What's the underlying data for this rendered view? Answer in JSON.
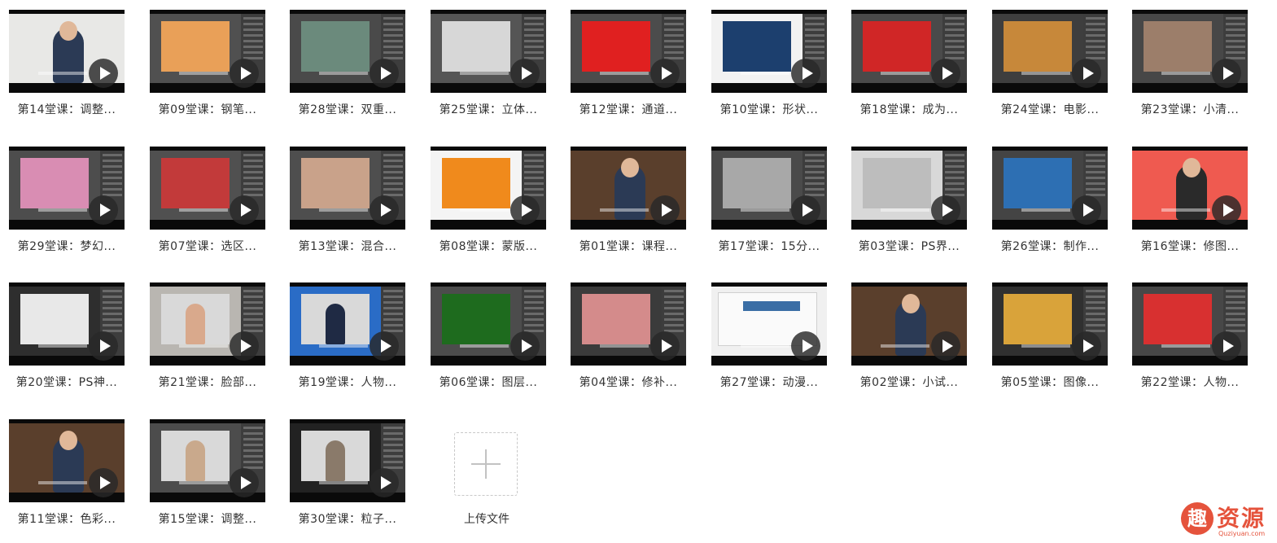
{
  "videos": [
    {
      "title": "第14堂课：调整...",
      "thumb": {
        "bg": "#e8e8e6",
        "ps": false,
        "accent": "#2b3a55",
        "person": true
      }
    },
    {
      "title": "第09堂课：钢笔...",
      "thumb": {
        "bg": "#505050",
        "ps": true,
        "accent": "#e9a058",
        "person": false
      }
    },
    {
      "title": "第28堂课：双重...",
      "thumb": {
        "bg": "#4a4a4a",
        "ps": true,
        "accent": "#6b8a7c",
        "person": false
      }
    },
    {
      "title": "第25堂课：立体...",
      "thumb": {
        "bg": "#555555",
        "ps": true,
        "accent": "#d7d7d7",
        "person": false
      }
    },
    {
      "title": "第12堂课：通道...",
      "thumb": {
        "bg": "#4c4c4c",
        "ps": true,
        "accent": "#e02020",
        "person": false
      }
    },
    {
      "title": "第10堂课：形状...",
      "thumb": {
        "bg": "#f2f2f2",
        "ps": true,
        "accent": "#1c3f6e",
        "person": false
      }
    },
    {
      "title": "第18堂课：成为...",
      "thumb": {
        "bg": "#4a4a4a",
        "ps": true,
        "accent": "#d02626",
        "person": false
      }
    },
    {
      "title": "第24堂课：电影...",
      "thumb": {
        "bg": "#3e3e3e",
        "ps": true,
        "accent": "#c7883a",
        "person": false
      }
    },
    {
      "title": "第23堂课：小清...",
      "thumb": {
        "bg": "#474747",
        "ps": true,
        "accent": "#9c7e6a",
        "person": false
      }
    },
    {
      "title": "第29堂课：梦幻...",
      "thumb": {
        "bg": "#4d4d4d",
        "ps": true,
        "accent": "#d98db3",
        "person": false
      }
    },
    {
      "title": "第07堂课：选区...",
      "thumb": {
        "bg": "#505050",
        "ps": true,
        "accent": "#c23a3a",
        "person": false
      }
    },
    {
      "title": "第13堂课：混合...",
      "thumb": {
        "bg": "#4e4e4e",
        "ps": true,
        "accent": "#c9a28a",
        "person": false
      }
    },
    {
      "title": "第08堂课：蒙版...",
      "thumb": {
        "bg": "#f4f4f4",
        "ps": true,
        "accent": "#f08a1c",
        "person": false
      }
    },
    {
      "title": "第01堂课：课程...",
      "thumb": {
        "bg": "#5a3f2c",
        "ps": false,
        "accent": "#2b3a55",
        "person": true
      }
    },
    {
      "title": "第17堂课：15分...",
      "thumb": {
        "bg": "#4a4a4a",
        "ps": true,
        "accent": "#a8a8a8",
        "person": false
      }
    },
    {
      "title": "第03堂课：PS界...",
      "thumb": {
        "bg": "#d8d8d8",
        "ps": true,
        "accent": "#bdbdbd",
        "person": false
      }
    },
    {
      "title": "第26堂课：制作...",
      "thumb": {
        "bg": "#444444",
        "ps": true,
        "accent": "#2d6fb3",
        "person": false
      }
    },
    {
      "title": "第16堂课：修图...",
      "thumb": {
        "bg": "#ef5a50",
        "ps": false,
        "accent": "#2a2a2a",
        "person": true
      }
    },
    {
      "title": "第20堂课：PS神...",
      "thumb": {
        "bg": "#2e2e2e",
        "ps": true,
        "accent": "#e8e8e8",
        "person": false
      }
    },
    {
      "title": "第21堂课：脸部...",
      "thumb": {
        "bg": "#b9b6b1",
        "ps": true,
        "accent": "#d9a98c",
        "person": true
      }
    },
    {
      "title": "第19堂课：人物...",
      "thumb": {
        "bg": "#2a6cc6",
        "ps": true,
        "accent": "#1f2a44",
        "person": true
      }
    },
    {
      "title": "第06堂课：图层...",
      "thumb": {
        "bg": "#4c4c4c",
        "ps": true,
        "accent": "#1e6b1e",
        "person": false
      }
    },
    {
      "title": "第04堂课：修补...",
      "thumb": {
        "bg": "#3b3b3b",
        "ps": true,
        "accent": "#d48b8b",
        "person": false
      }
    },
    {
      "title": "第27堂课：动漫...",
      "thumb": {
        "bg": "#f0f0f0",
        "ps": false,
        "accent": "#3a6ea5",
        "person": false
      }
    },
    {
      "title": "第02堂课：小试...",
      "thumb": {
        "bg": "#5a3f2c",
        "ps": false,
        "accent": "#2b3a55",
        "person": true
      }
    },
    {
      "title": "第05堂课：图像...",
      "thumb": {
        "bg": "#303030",
        "ps": true,
        "accent": "#d9a33a",
        "person": false
      }
    },
    {
      "title": "第22堂课：人物...",
      "thumb": {
        "bg": "#474747",
        "ps": true,
        "accent": "#d83030",
        "person": false
      }
    },
    {
      "title": "第11堂课：色彩...",
      "thumb": {
        "bg": "#5a3f2c",
        "ps": false,
        "accent": "#2b3a55",
        "person": true
      }
    },
    {
      "title": "第15堂课：调整...",
      "thumb": {
        "bg": "#4c4c4c",
        "ps": true,
        "accent": "#c9a98c",
        "person": true
      }
    },
    {
      "title": "第30堂课：粒子...",
      "thumb": {
        "bg": "#222222",
        "ps": true,
        "accent": "#8a7a6a",
        "person": true
      }
    }
  ],
  "upload": {
    "label": "上传文件"
  },
  "watermark": {
    "badge": "趣",
    "text": "资源",
    "sub": "Quziyuan.com"
  }
}
